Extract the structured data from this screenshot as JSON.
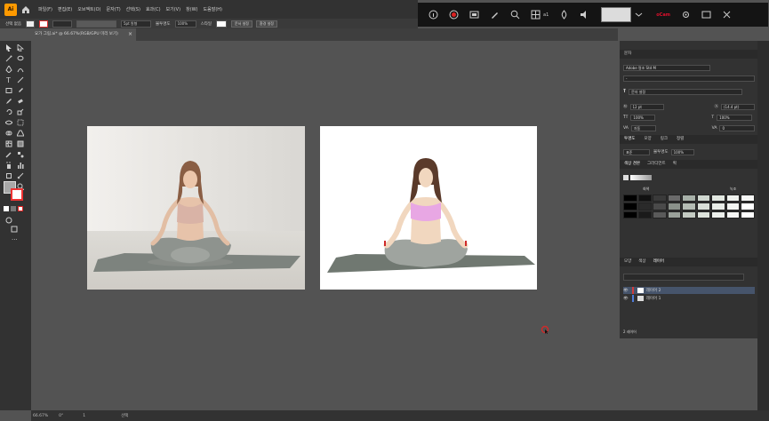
{
  "app": {
    "logo": "Ai"
  },
  "menu": [
    "파일(F)",
    "편집(E)",
    "오브젝트(O)",
    "문자(T)",
    "선택(S)",
    "효과(C)",
    "보기(V)",
    "창(W)",
    "도움말(H)"
  ],
  "control_bar": {
    "selection_label": "선택 없음",
    "stroke_weight": "5pt 원형",
    "opacity_label": "불투명도",
    "opacity_value": "100%",
    "style_label": "스타일",
    "doc_setup_button": "문서 설정",
    "prefs_button": "환경 설정"
  },
  "recorder": {
    "counter": "a1",
    "label": "oCam"
  },
  "document_tab": {
    "title": "요가 그림.ai* @ 66.67%(RGB/GPU 미리 보기)",
    "close": "×"
  },
  "character_panel": {
    "title": "문자",
    "font_family": "Adobe 명조 Std M",
    "font_style": "-",
    "touch_type": "문자 설정",
    "font_size": "12 pt",
    "leading": "(14.4 pt)",
    "vscale": "100%",
    "hscale": "100%",
    "kerning": "자동",
    "tracking": "0"
  },
  "transparency_panel": {
    "tabs": [
      "투명도",
      "모양",
      "링크",
      "정렬"
    ],
    "blend_mode": "표준",
    "opacity_label": "불투명도",
    "opacity_value": "100%"
  },
  "swatch_panel": {
    "tabs": [
      "색상 견본",
      "그라디언트",
      "획"
    ],
    "group_labels": [
      "회색",
      "녹조"
    ]
  },
  "layers_panel": {
    "tabs": [
      "모양",
      "색상",
      "레이어"
    ],
    "layers": [
      {
        "name": "레이어 2",
        "color": "#cf3c3c"
      },
      {
        "name": "레이어 1",
        "color": "#4f7bd8"
      }
    ],
    "count": "2 레이어"
  },
  "status_bar": {
    "zoom": "66.67%",
    "angle": "0°",
    "artboard": "1",
    "mode": "선택"
  },
  "colors": {
    "mat": "#707871",
    "skin": "#f1d7bf",
    "hair": "#5a3a2a",
    "top_vector": "#e8a7e4",
    "pants": "#9fa49f",
    "accent": "#cf2a2a"
  }
}
